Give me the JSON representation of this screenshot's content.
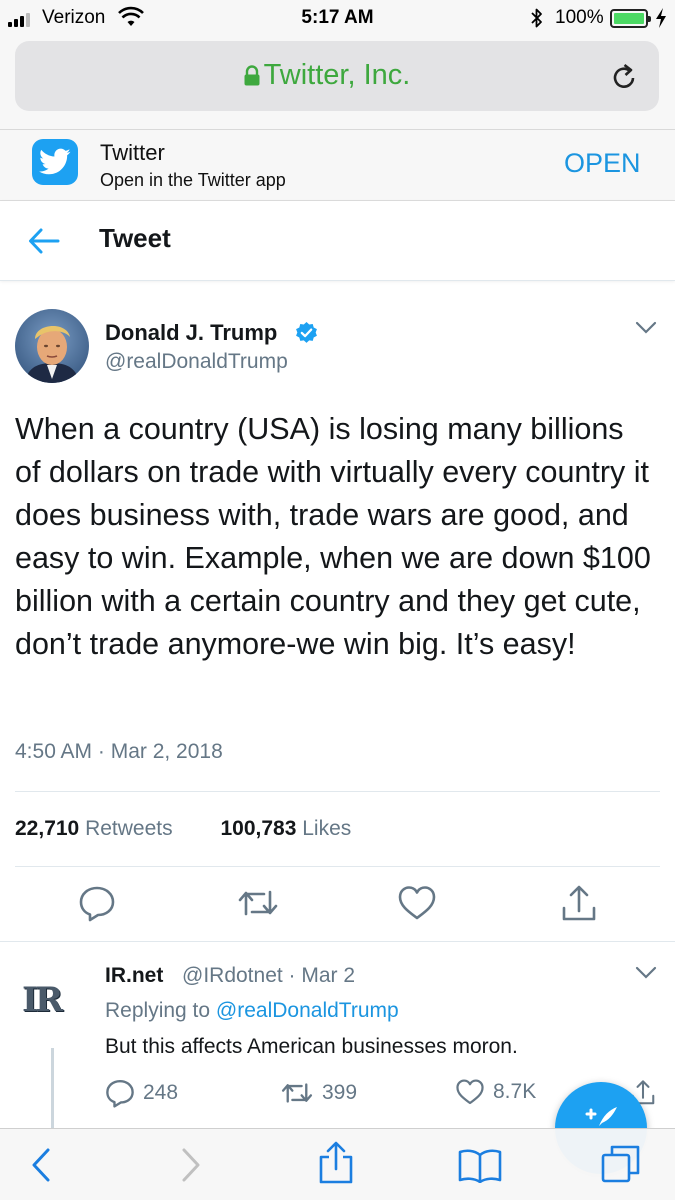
{
  "status_bar": {
    "carrier": "Verizon",
    "time": "5:17 AM",
    "battery": "100%"
  },
  "browser": {
    "url_title": "Twitter, Inc.",
    "secure": true
  },
  "app_banner": {
    "app_name": "Twitter",
    "subtitle": "Open in the Twitter app",
    "open_label": "OPEN"
  },
  "header": {
    "title": "Tweet"
  },
  "tweet": {
    "author": "Donald J. Trump",
    "handle": "@realDonaldTrump",
    "text": "When a country (USA) is losing many billions of dollars on trade with virtually every country it does business with, trade wars are good, and easy to win. Example, when we are down $100 billion with a certain country and they get cute, don’t trade anymore-we win big. It’s easy!",
    "timestamp": "4:50 AM · Mar 2, 2018",
    "retweets_count": "22,710",
    "retweets_label": "Retweets",
    "likes_count": "100,783",
    "likes_label": "Likes"
  },
  "reply": {
    "logo_text": "IR",
    "name": "IR.net",
    "handle_date": "@IRdotnet · Mar 2",
    "replying_prefix": "Replying to",
    "replying_to": "@realDonaldTrump",
    "text": "But this affects American businesses moron.",
    "reply_count": "248",
    "retweet_count": "399",
    "like_count": "8.7K"
  },
  "colors": {
    "accent": "#1da1f2",
    "link": "#1b95e0",
    "secure_green": "#3ea83e",
    "muted": "#657786"
  },
  "icons": [
    "signal-icon",
    "wifi-icon",
    "bluetooth-icon",
    "battery-icon",
    "lock-icon",
    "reload-icon",
    "twitter-bird-icon",
    "back-arrow-icon",
    "verified-badge-icon",
    "chevron-down-icon",
    "reply-icon",
    "retweet-icon",
    "like-icon",
    "share-icon",
    "compose-icon",
    "browser-back-icon",
    "browser-forward-icon",
    "browser-share-icon",
    "bookmarks-icon",
    "tabs-icon"
  ]
}
